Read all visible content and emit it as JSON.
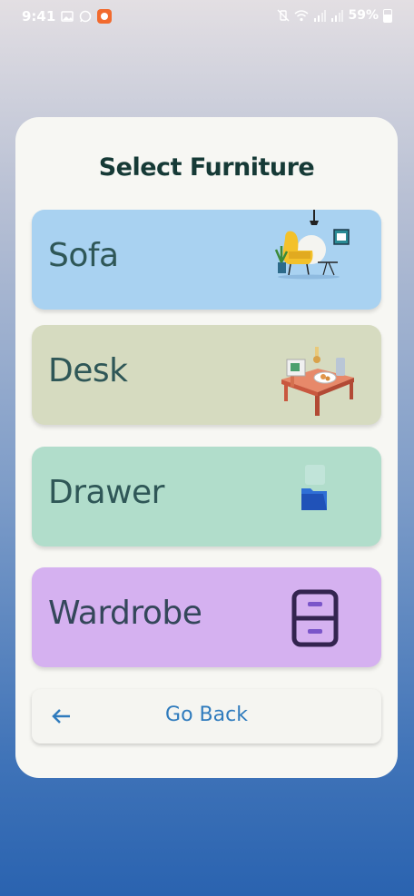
{
  "status_bar": {
    "time": "9:41",
    "battery": "59%",
    "left_icons": [
      "gallery-icon",
      "whatsapp-icon",
      "app-notification-icon"
    ],
    "right_icons": [
      "mute-vibrate-icon",
      "wifi-icon",
      "signal-icon",
      "signal-icon",
      "battery-icon"
    ]
  },
  "page": {
    "title": "Select Furniture"
  },
  "options": [
    {
      "label": "Sofa",
      "color": "#a9d2f1",
      "icon": "sofa-illustration"
    },
    {
      "label": "Desk",
      "color": "#d6dbc0",
      "icon": "desk-illustration"
    },
    {
      "label": "Drawer",
      "color": "#b1ddcb",
      "icon": "folder-icon"
    },
    {
      "label": "Wardrobe",
      "color": "#d5b1f0",
      "icon": "wardrobe-icon"
    }
  ],
  "back": {
    "label": "Go Back",
    "icon": "arrow-left-icon",
    "color": "#2f7bbd"
  }
}
